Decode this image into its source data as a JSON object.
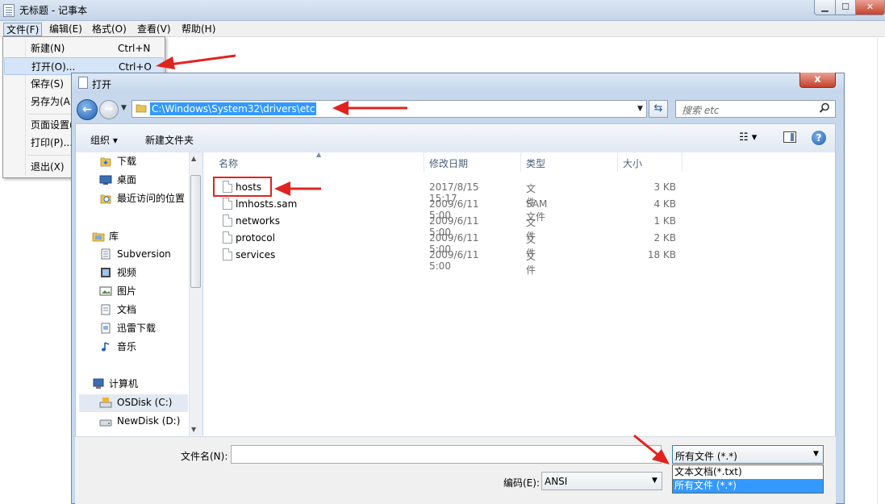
{
  "notepad": {
    "title": "无标题 - 记事本",
    "menu": {
      "file": "文件(F)",
      "edit": "编辑(E)",
      "format": "格式(O)",
      "view": "查看(V)",
      "help": "帮助(H)"
    },
    "file_menu": {
      "new_label": "新建(N)",
      "new_shortcut": "Ctrl+N",
      "open_label": "打开(O)...",
      "open_shortcut": "Ctrl+O",
      "save_label": "保存(S)",
      "saveas_label": "另存为(A)",
      "pagesetup_label": "页面设置(",
      "print_label": "打印(P)...",
      "exit_label": "退出(X)"
    }
  },
  "dialog": {
    "title": "打开",
    "close_glyph": "x",
    "address": "C:\\Windows\\System32\\drivers\\etc",
    "search_placeholder": "搜索 etc",
    "toolbar": {
      "organize": "组织 ▾",
      "new_folder": "新建文件夹",
      "view_glyph": "☷ ▾",
      "help_glyph": "?"
    },
    "nav": {
      "downloads": "下载",
      "desktop": "桌面",
      "recent": "最近访问的位置",
      "library": "库",
      "subversion": "Subversion",
      "videos": "视频",
      "pictures": "图片",
      "documents": "文档",
      "xunlei": "迅雷下载",
      "music": "音乐",
      "computer": "计算机",
      "osdisk": "OSDisk (C:)",
      "newdisk": "NewDisk (D:)"
    },
    "columns": {
      "name": "名称",
      "date": "修改日期",
      "type": "类型",
      "size": "大小"
    },
    "files": [
      {
        "name": "hosts",
        "date": "2017/8/15 15:17",
        "type": "文件",
        "size": "3 KB"
      },
      {
        "name": "lmhosts.sam",
        "date": "2009/6/11 5:00",
        "type": "SAM 文件",
        "size": "4 KB"
      },
      {
        "name": "networks",
        "date": "2009/6/11 5:00",
        "type": "文件",
        "size": "1 KB"
      },
      {
        "name": "protocol",
        "date": "2009/6/11 5:00",
        "type": "文件",
        "size": "2 KB"
      },
      {
        "name": "services",
        "date": "2009/6/11 5:00",
        "type": "文件",
        "size": "18 KB"
      }
    ],
    "filename_label": "文件名(N):",
    "filename_value": "",
    "filter_selected": "所有文件  (*.*)",
    "filter_options": [
      "文本文档(*.txt)",
      "所有文件  (*.*)"
    ],
    "encoding_label": "编码(E):",
    "encoding_value": "ANSI"
  },
  "colors": {
    "annotation_red": "#e0231f",
    "selection_blue": "#3399ff"
  }
}
